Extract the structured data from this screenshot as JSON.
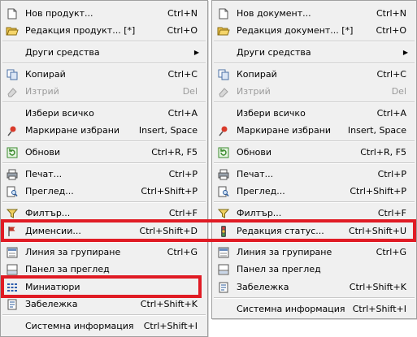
{
  "left_menu": {
    "items": [
      {
        "label": "Нов продукт...",
        "shortcut": "Ctrl+N",
        "icon": "new-document-icon"
      },
      {
        "label": "Редакция продукт... [*]",
        "shortcut": "Ctrl+O",
        "icon": "open-folder-icon"
      },
      {
        "label": "Други средства",
        "shortcut": "",
        "icon": "",
        "submenu_arrow": "▶"
      },
      {
        "label": "Копирай",
        "shortcut": "Ctrl+C",
        "icon": "copy-icon"
      },
      {
        "label": "Изтрий",
        "shortcut": "Del",
        "icon": "eraser-icon",
        "disabled": true
      },
      {
        "label": "Избери всичко",
        "shortcut": "Ctrl+A",
        "icon": ""
      },
      {
        "label": "Маркиране избрани",
        "shortcut": "Insert, Space",
        "icon": "pin-icon"
      },
      {
        "label": "Обнови",
        "shortcut": "Ctrl+R, F5",
        "icon": "refresh-icon"
      },
      {
        "label": "Печат...",
        "shortcut": "Ctrl+P",
        "icon": "printer-icon"
      },
      {
        "label": "Преглед...",
        "shortcut": "Ctrl+Shift+P",
        "icon": "print-preview-icon"
      },
      {
        "label": "Филтър...",
        "shortcut": "Ctrl+F",
        "icon": "filter-icon"
      },
      {
        "label": "Дименсии...",
        "shortcut": "Ctrl+Shift+D",
        "icon": "flag-icon",
        "highlighted": true
      },
      {
        "label": "Линия за групиране",
        "shortcut": "Ctrl+G",
        "icon": "group-line-icon"
      },
      {
        "label": "Панел за преглед",
        "shortcut": "",
        "icon": "preview-panel-icon"
      },
      {
        "label": "Миниатюри",
        "shortcut": "",
        "icon": "thumbnails-icon",
        "highlighted": true
      },
      {
        "label": "Забележка",
        "shortcut": "Ctrl+Shift+K",
        "icon": "note-icon"
      },
      {
        "label": "Системна информация",
        "shortcut": "Ctrl+Shift+I",
        "icon": ""
      }
    ]
  },
  "right_menu": {
    "items": [
      {
        "label": "Нов документ...",
        "shortcut": "Ctrl+N",
        "icon": "new-document-icon"
      },
      {
        "label": "Редакция документ... [*]",
        "shortcut": "Ctrl+O",
        "icon": "open-folder-icon"
      },
      {
        "label": "Други средства",
        "shortcut": "",
        "icon": "",
        "submenu_arrow": "▶"
      },
      {
        "label": "Копирай",
        "shortcut": "Ctrl+C",
        "icon": "copy-icon"
      },
      {
        "label": "Изтрий",
        "shortcut": "Del",
        "icon": "eraser-icon",
        "disabled": true
      },
      {
        "label": "Избери всичко",
        "shortcut": "Ctrl+A",
        "icon": ""
      },
      {
        "label": "Маркиране избрани",
        "shortcut": "Insert, Space",
        "icon": "pin-icon"
      },
      {
        "label": "Обнови",
        "shortcut": "Ctrl+R, F5",
        "icon": "refresh-icon"
      },
      {
        "label": "Печат...",
        "shortcut": "Ctrl+P",
        "icon": "printer-icon"
      },
      {
        "label": "Преглед...",
        "shortcut": "Ctrl+Shift+P",
        "icon": "print-preview-icon"
      },
      {
        "label": "Филтър...",
        "shortcut": "Ctrl+F",
        "icon": "filter-icon"
      },
      {
        "label": "Редакция статус...",
        "shortcut": "Ctrl+Shift+U",
        "icon": "traffic-light-icon",
        "highlighted": true
      },
      {
        "label": "Линия за групиране",
        "shortcut": "Ctrl+G",
        "icon": "group-line-icon"
      },
      {
        "label": "Панел за преглед",
        "shortcut": "",
        "icon": "preview-panel-icon"
      },
      {
        "label": "Забележка",
        "shortcut": "Ctrl+Shift+K",
        "icon": "note-icon"
      },
      {
        "label": "Системна информация",
        "shortcut": "Ctrl+Shift+I",
        "icon": ""
      }
    ]
  },
  "colors": {
    "menu_background": "#f0f0f0",
    "highlight_border": "#e01b24",
    "disabled_text": "#9a9a9a"
  }
}
